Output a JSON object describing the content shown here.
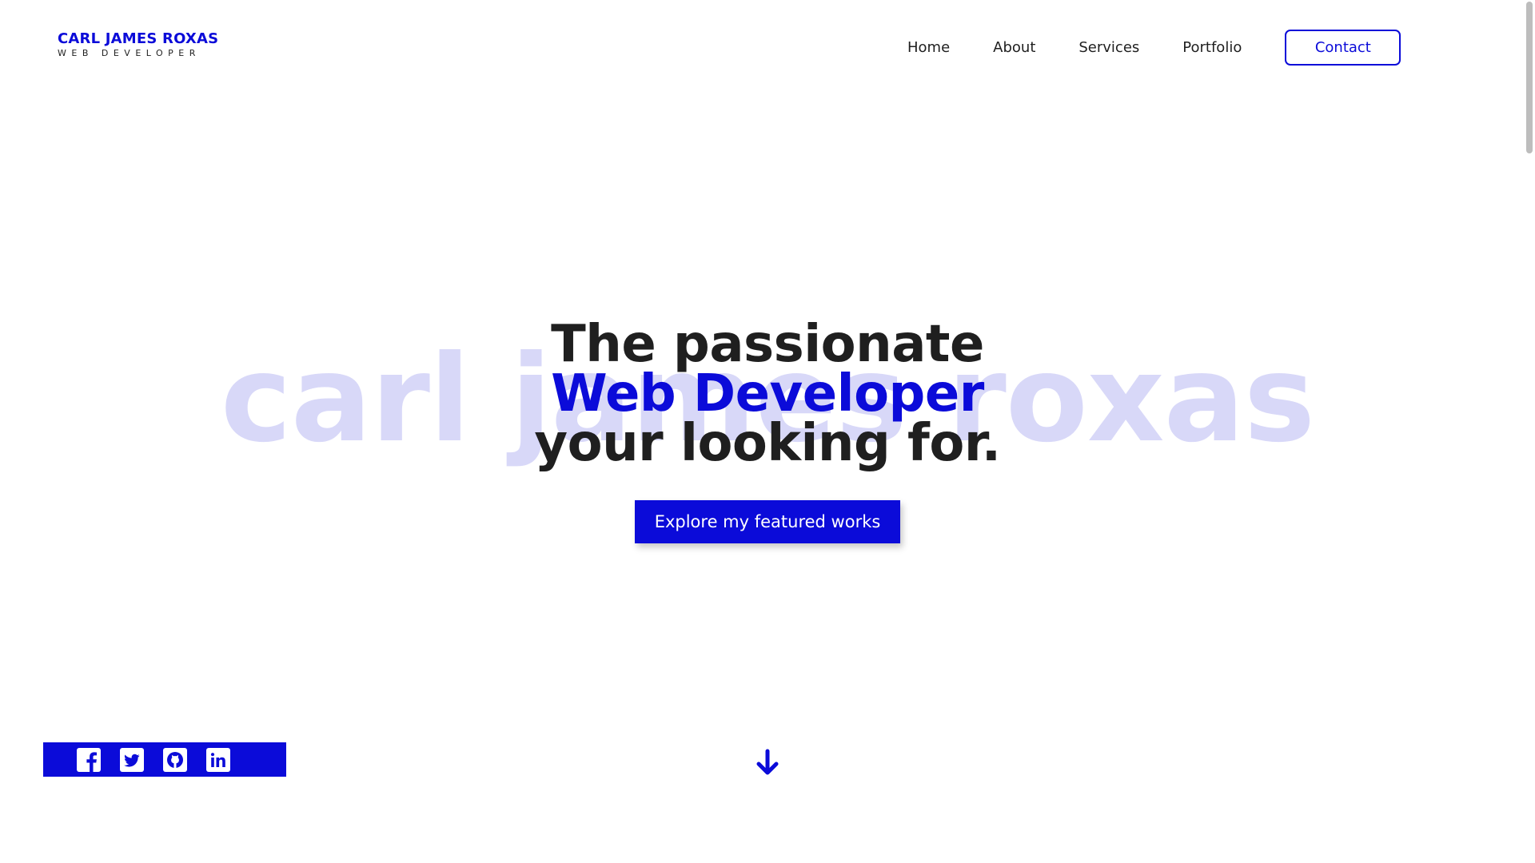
{
  "brand": {
    "name": "CARL JAMES ROXAS",
    "tagline": "WEB DEVELOPER"
  },
  "nav": {
    "items": [
      {
        "label": "Home"
      },
      {
        "label": "About"
      },
      {
        "label": "Services"
      },
      {
        "label": "Portfolio"
      }
    ],
    "contact_label": "Contact"
  },
  "hero": {
    "background_text": "carl james roxas",
    "line1": "The passionate",
    "line2": "Web Developer",
    "line3": "your looking for.",
    "cta_label": "Explore my featured works"
  },
  "social": {
    "icons": [
      "facebook-icon",
      "twitter-icon",
      "github-icon",
      "linkedin-icon"
    ]
  },
  "scroll_indicator": {
    "icon": "arrow-down-icon"
  },
  "colors": {
    "accent": "#0b0bd9",
    "text": "#1f1f1f",
    "background_text": "#d8d8f8",
    "background": "#ffffff"
  }
}
